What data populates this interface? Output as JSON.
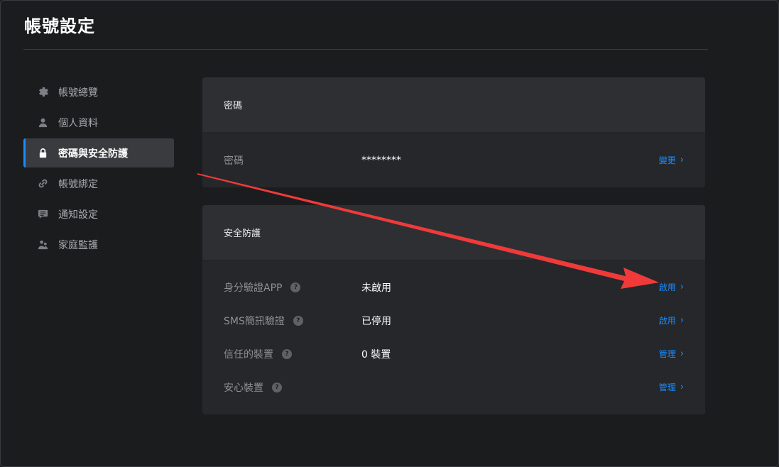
{
  "page": {
    "title": "帳號設定"
  },
  "sidebar": {
    "items": [
      {
        "label": "帳號總覽",
        "icon": "gear-icon"
      },
      {
        "label": "個人資料",
        "icon": "user-icon"
      },
      {
        "label": "密碼與安全防護",
        "icon": "lock-icon"
      },
      {
        "label": "帳號綁定",
        "icon": "link-icon"
      },
      {
        "label": "通知設定",
        "icon": "message-icon"
      },
      {
        "label": "家庭監護",
        "icon": "family-icon"
      }
    ],
    "active_index": 2
  },
  "password_card": {
    "title": "密碼",
    "row": {
      "label": "密碼",
      "value": "********",
      "action": "變更"
    }
  },
  "security_card": {
    "title": "安全防護",
    "rows": [
      {
        "label": "身分驗證APP",
        "value": "未啟用",
        "action": "啟用"
      },
      {
        "label": "SMS簡訊驗證",
        "value": "已停用",
        "action": "啟用"
      },
      {
        "label": "信任的裝置",
        "value": "0 裝置",
        "action": "管理"
      },
      {
        "label": "安心裝置",
        "value": "",
        "action": "管理"
      }
    ]
  },
  "help_glyph": "?",
  "chevron_glyph": "›",
  "colors": {
    "accent": "#1a8cff",
    "annotation_arrow": "#f03a3a"
  }
}
